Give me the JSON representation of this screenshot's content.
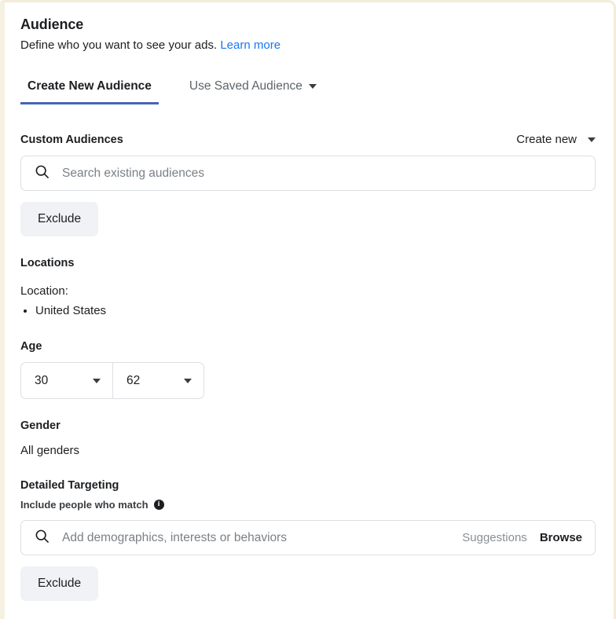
{
  "header": {
    "title": "Audience",
    "subtitle": "Define who you want to see your ads.",
    "learn_more": "Learn more"
  },
  "tabs": [
    {
      "label": "Create New Audience",
      "active": true
    },
    {
      "label": "Use Saved Audience",
      "active": false,
      "has_caret": true
    }
  ],
  "custom_audiences": {
    "title": "Custom Audiences",
    "create_new_label": "Create new",
    "search_placeholder": "Search existing audiences",
    "search_icon": "search-icon",
    "exclude_label": "Exclude"
  },
  "locations": {
    "title": "Locations",
    "location_label": "Location:",
    "items": [
      "United States"
    ]
  },
  "age": {
    "title": "Age",
    "min": "30",
    "max": "62"
  },
  "gender": {
    "title": "Gender",
    "value": "All genders"
  },
  "detailed_targeting": {
    "title": "Detailed Targeting",
    "include_label": "Include people who match",
    "info_icon": "info-icon",
    "info_glyph": "i",
    "search_placeholder": "Add demographics, interests or behaviors",
    "suggestions_label": "Suggestions",
    "browse_label": "Browse",
    "exclude_label": "Exclude"
  },
  "colors": {
    "link": "#1877F2",
    "tab_underline": "#4267B2",
    "text": "#1C1E21",
    "muted": "#7B8085",
    "button_bg": "#F0F2F5",
    "border": "#DCDFE3",
    "frame_border": "#F2ECD9"
  }
}
